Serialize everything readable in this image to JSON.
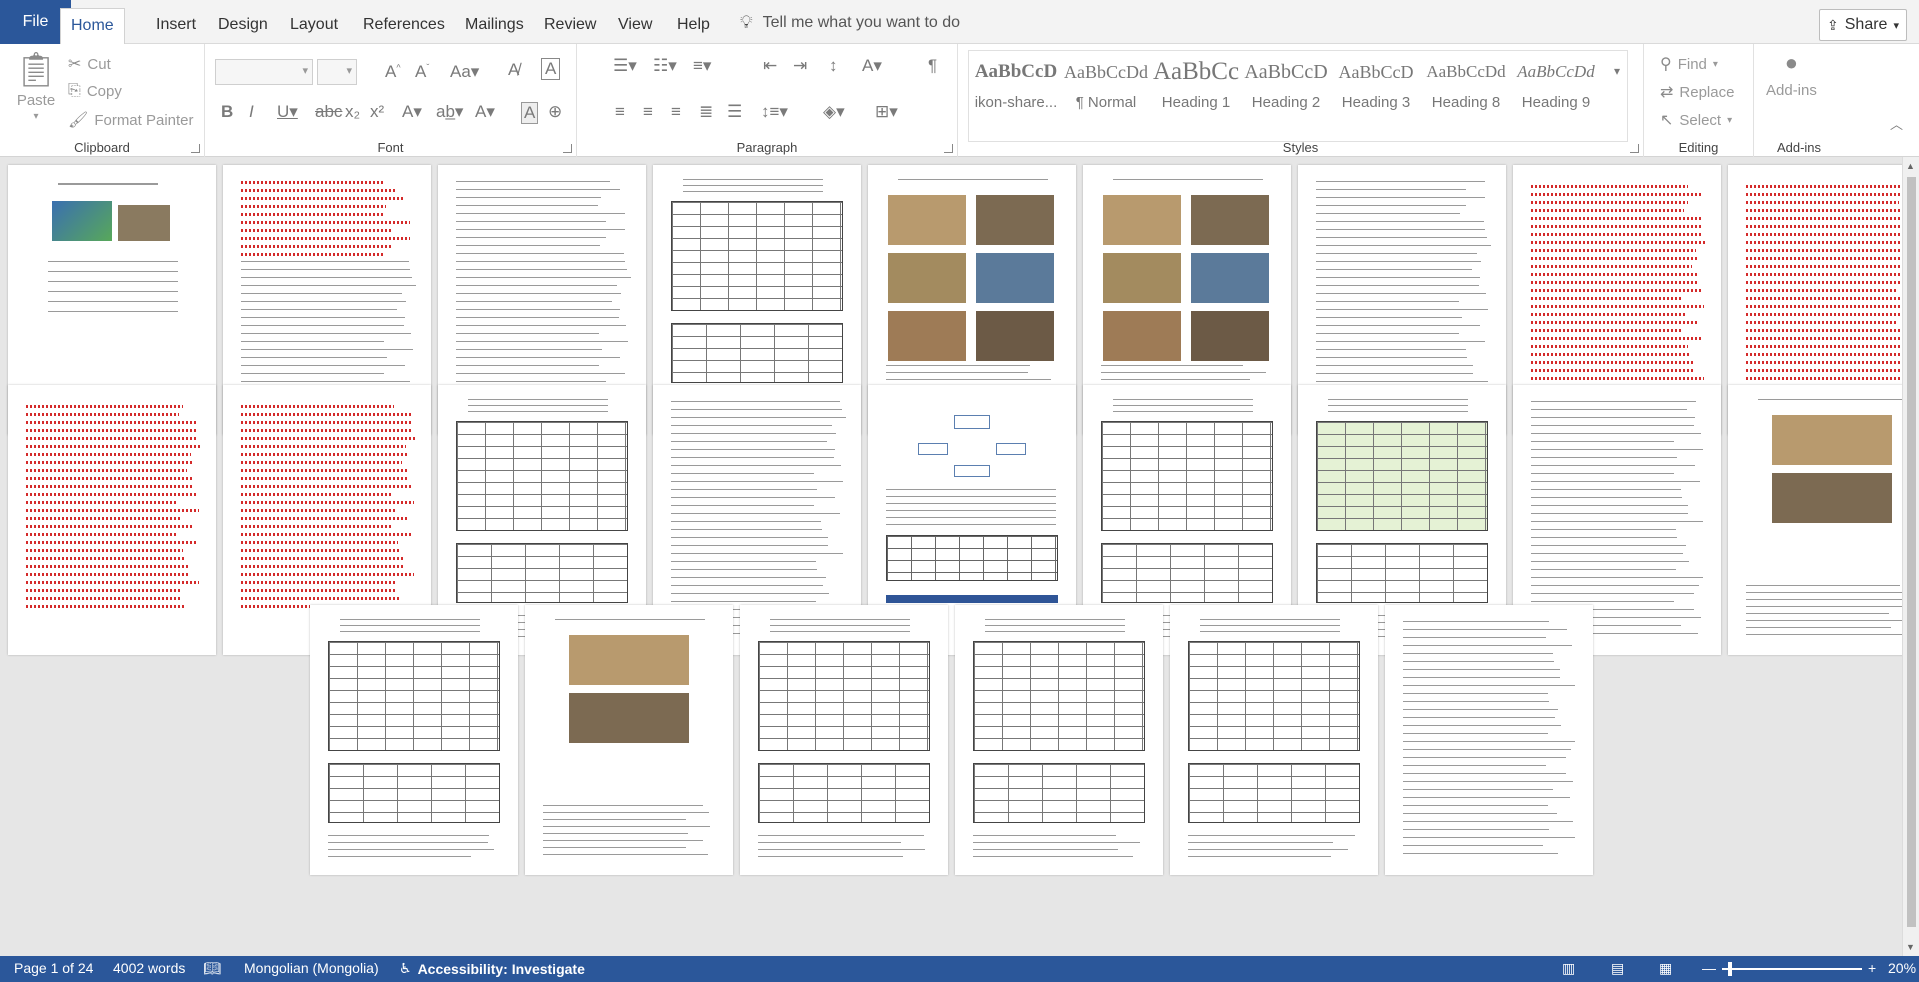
{
  "ribbon_tabs": {
    "file": "File",
    "tabs": [
      "Home",
      "Insert",
      "Design",
      "Layout",
      "References",
      "Mailings",
      "Review",
      "View",
      "Help"
    ],
    "active": "Home",
    "tell_me": "Tell me what you want to do",
    "share": "Share"
  },
  "clipboard": {
    "paste": "Paste",
    "cut": "Cut",
    "copy": "Copy",
    "format_painter": "Format Painter",
    "label": "Clipboard"
  },
  "font": {
    "label": "Font",
    "font_name": "",
    "font_size": ""
  },
  "paragraph": {
    "label": "Paragraph"
  },
  "styles": {
    "label": "Styles",
    "items": [
      {
        "sample": "AaBbCcD",
        "name": "ikon-share..."
      },
      {
        "sample": "AaBbCcDd",
        "name": "¶ Normal"
      },
      {
        "sample": "AaBbCc",
        "name": "Heading 1"
      },
      {
        "sample": "AaBbCcD",
        "name": "Heading 2"
      },
      {
        "sample": "AaBbCcD",
        "name": "Heading 3"
      },
      {
        "sample": "AaBbCcDd",
        "name": "Heading 8"
      },
      {
        "sample": "AaBbCcDd",
        "name": "Heading 9"
      }
    ]
  },
  "editing": {
    "label": "Editing",
    "find": "Find",
    "replace": "Replace",
    "select": "Select"
  },
  "addins": {
    "label": "Add-ins",
    "button": "Add-ins"
  },
  "status_bar": {
    "page": "Page 1 of 24",
    "words": "4002 words",
    "language": "Mongolian (Mongolia)",
    "accessibility": "Accessibility: Investigate",
    "zoom": "20%",
    "zoom_minus": "—",
    "zoom_plus": "+"
  },
  "document": {
    "page_count": 24,
    "pages_per_row": [
      9,
      9,
      6
    ]
  }
}
